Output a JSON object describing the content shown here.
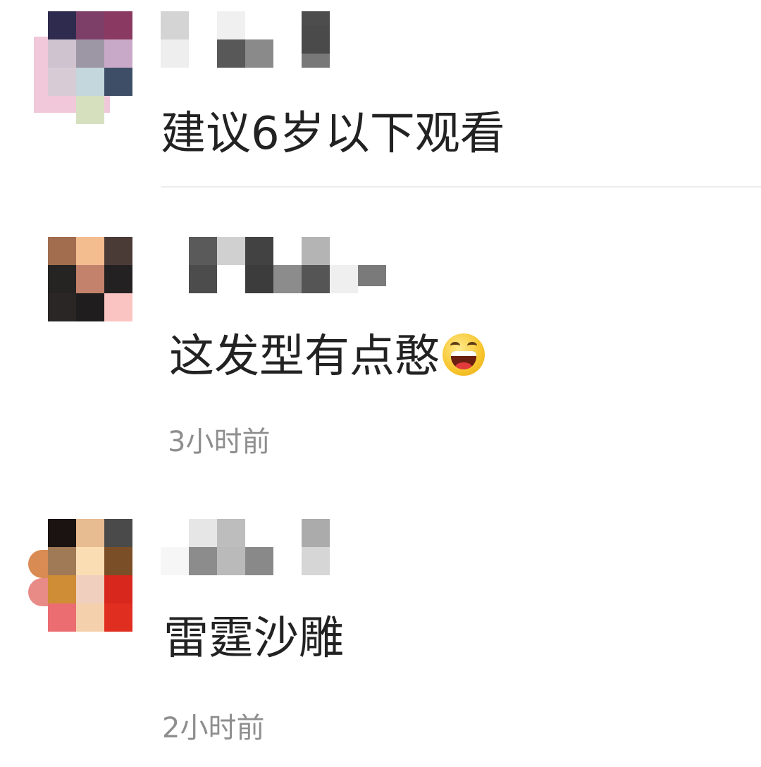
{
  "comments": [
    {
      "avatar_colors": [
        "#2e2b4f",
        "#7d3f68",
        "#8a3a62",
        "#cfc3cf",
        "#9d97a5",
        "#c9a9c8",
        "#d7cbd6",
        "#c3d7dd",
        "#3d4e66"
      ],
      "avatar_extra_color": "#d6e0bf",
      "username_colors": [
        "#d4d4d4",
        "#f0f0f0",
        "#585858",
        "#eeeeee",
        "#4d4d4d",
        "#8a8a8a",
        "#787878",
        "#4a4a4a"
      ],
      "text": "建议6岁以下观看",
      "timestamp": ""
    },
    {
      "avatar_colors": [
        "#a26d4f",
        "#f3bd90",
        "#4b3b36",
        "#262323",
        "#c3826b",
        "#232121",
        "#2a2626",
        "#1f1d1d",
        "#fac4c2"
      ],
      "username_colors": [
        "#5a5a5a",
        "#d0d0d0",
        "#424242",
        "#b4b4b4",
        "#4c4c4c",
        "#3c3c3c",
        "#8c8c8c",
        "#555555",
        "#efefef",
        "#7a7a7a"
      ],
      "text": "这发型有点憨",
      "emoji": "laughing-face-icon",
      "timestamp": "3小时前"
    },
    {
      "avatar_colors": [
        "#1a1312",
        "#e7bc90",
        "#4a4a4a",
        "#a07a57",
        "#fbddb3",
        "#7a4f27",
        "#cf8d35",
        "#f0cfbe",
        "#d8271c",
        "#eb6d72",
        "#f5d0ac",
        "#e02e20"
      ],
      "avatar_side_colors": [
        "#d98b54",
        "#e88a86"
      ],
      "username_colors": [
        "#f6f6f6",
        "#e6e6e6",
        "#bdbdbd",
        "#ababab",
        "#8c8c8c",
        "#bababa",
        "#898989",
        "#d6d6d6"
      ],
      "text": "雷霆沙雕",
      "timestamp": "2小时前"
    }
  ]
}
